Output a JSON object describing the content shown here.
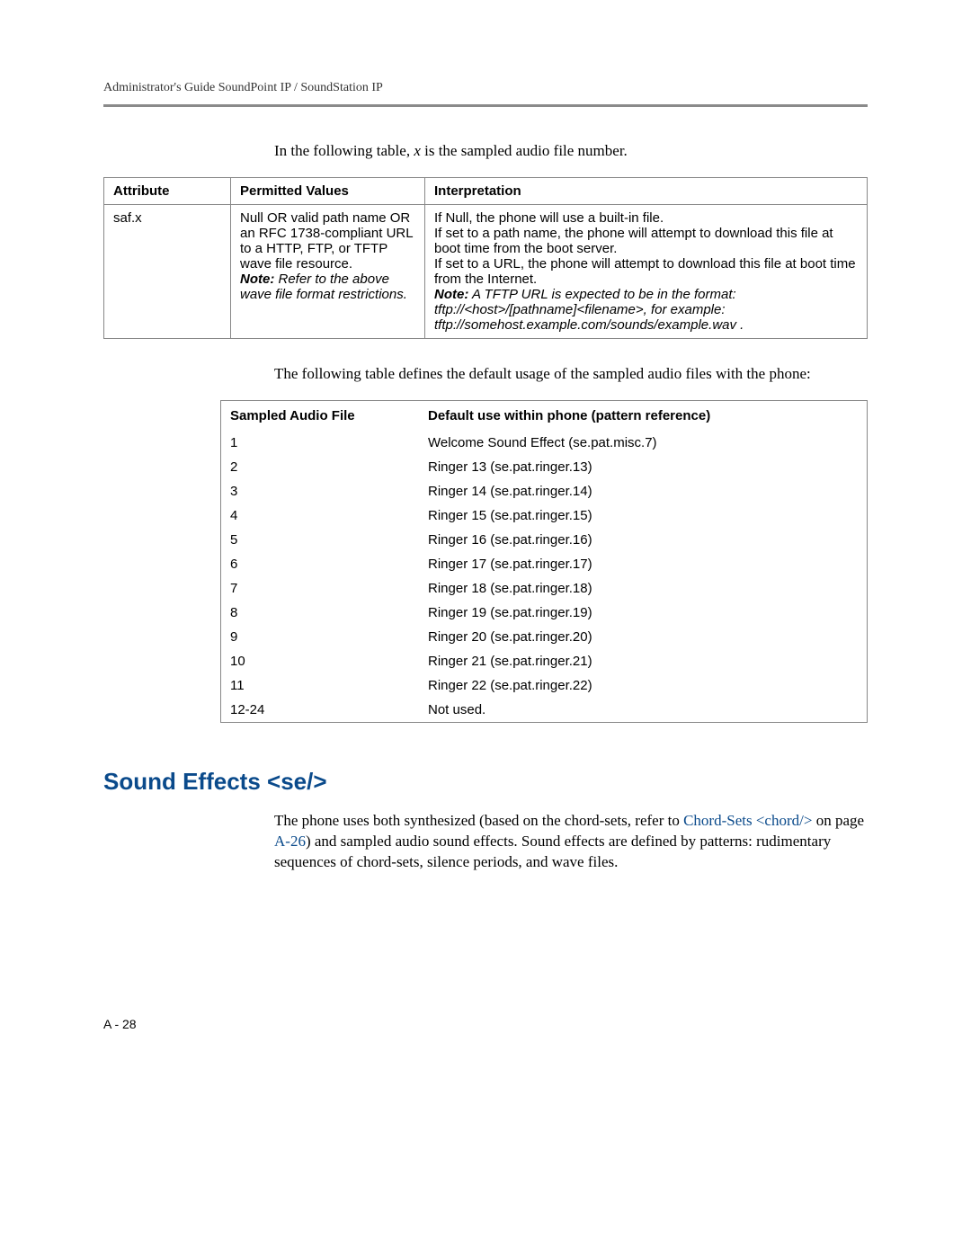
{
  "header": {
    "running_head": "Administrator's Guide SoundPoint IP / SoundStation IP"
  },
  "intro1_pre": "In the following table, ",
  "intro1_var": "x",
  "intro1_post": " is the sampled audio file number.",
  "table1": {
    "headers": {
      "c1": "Attribute",
      "c2": "Permitted Values",
      "c3": "Interpretation"
    },
    "row": {
      "attr": "saf.x",
      "perm_main": "Null OR valid path name OR an RFC 1738-compliant URL to a HTTP, FTP, or TFTP wave file resource.",
      "perm_note_label": "Note:",
      "perm_note_rest": " Refer to the above wave file format restrictions.",
      "interp_l1": "If Null, the phone will use a built-in file.",
      "interp_l2": "If set to a path name, the phone will attempt to download this file at boot time from the boot server.",
      "interp_l3": "If set to a URL, the phone will attempt to download this file at boot time from the Internet.",
      "interp_note_label": "Note:",
      "interp_note_rest": " A TFTP URL is expected to be in the format: tftp://<host>/[pathname]<filename>, for example: tftp://somehost.example.com/sounds/example.wav ."
    }
  },
  "intro2": "The following table defines the default usage of the sampled audio files with the phone:",
  "table2": {
    "headers": {
      "c1": "Sampled Audio File",
      "c2": "Default use within phone (pattern reference)"
    },
    "rows": [
      {
        "a": "1",
        "b": "Welcome Sound Effect (se.pat.misc.7)"
      },
      {
        "a": "2",
        "b": "Ringer 13 (se.pat.ringer.13)"
      },
      {
        "a": "3",
        "b": "Ringer 14 (se.pat.ringer.14)"
      },
      {
        "a": "4",
        "b": "Ringer 15 (se.pat.ringer.15)"
      },
      {
        "a": "5",
        "b": "Ringer 16 (se.pat.ringer.16)"
      },
      {
        "a": "6",
        "b": "Ringer 17 (se.pat.ringer.17)"
      },
      {
        "a": "7",
        "b": "Ringer 18 (se.pat.ringer.18)"
      },
      {
        "a": "8",
        "b": "Ringer 19 (se.pat.ringer.19)"
      },
      {
        "a": "9",
        "b": "Ringer 20 (se.pat.ringer.20)"
      },
      {
        "a": "10",
        "b": "Ringer 21 (se.pat.ringer.21)"
      },
      {
        "a": "11",
        "b": "Ringer 22 (se.pat.ringer.22)"
      },
      {
        "a": "12-24",
        "b": "Not used."
      }
    ]
  },
  "section": {
    "title": "Sound Effects <se/>",
    "body_pre": "The phone uses both synthesized (based on the chord-sets, refer to ",
    "body_link1": "Chord-Sets <chord/>",
    "body_mid1": " on page ",
    "body_link2": "A-26",
    "body_post": ") and sampled audio sound effects. Sound effects are defined by patterns: rudimentary sequences of chord-sets, silence periods, and wave files."
  },
  "footer": {
    "page_number": "A - 28"
  }
}
